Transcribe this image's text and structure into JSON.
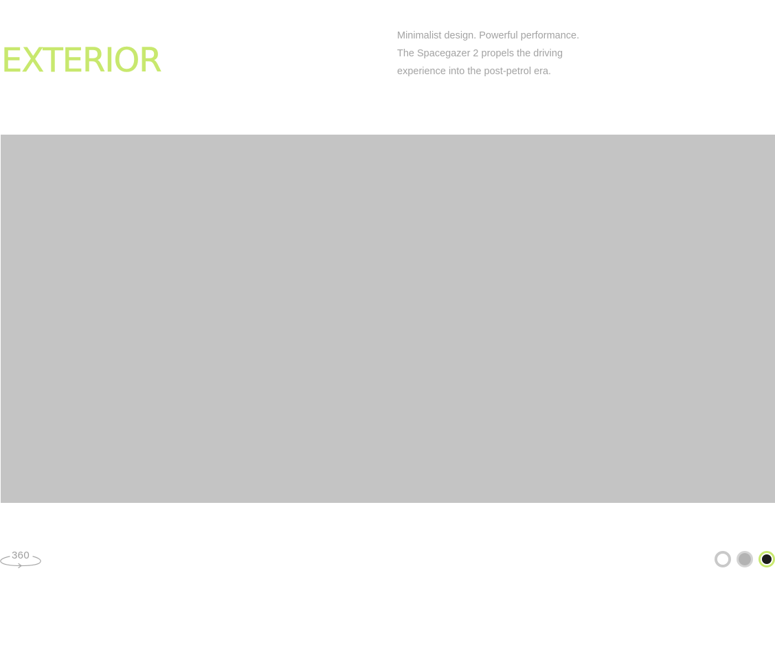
{
  "header": {
    "title": "EXTERIOR",
    "title_color": "#c8e86e",
    "description_lines": [
      "Minimalist design. Powerful performance.",
      "The Spacegazer 2 propels the driving",
      "experience into the post-petrol era."
    ]
  },
  "viewer": {
    "background_color": "#c4c4c4"
  },
  "rotate_control": {
    "label": "360",
    "icon": "rotate-360-icon"
  },
  "color_options": [
    {
      "name": "white",
      "color": "#ffffff",
      "selected": false
    },
    {
      "name": "grey",
      "color": "#b3b3b3",
      "selected": false
    },
    {
      "name": "black",
      "color": "#1c1c1c",
      "selected": true
    }
  ],
  "accent_color": "#c8e86e"
}
